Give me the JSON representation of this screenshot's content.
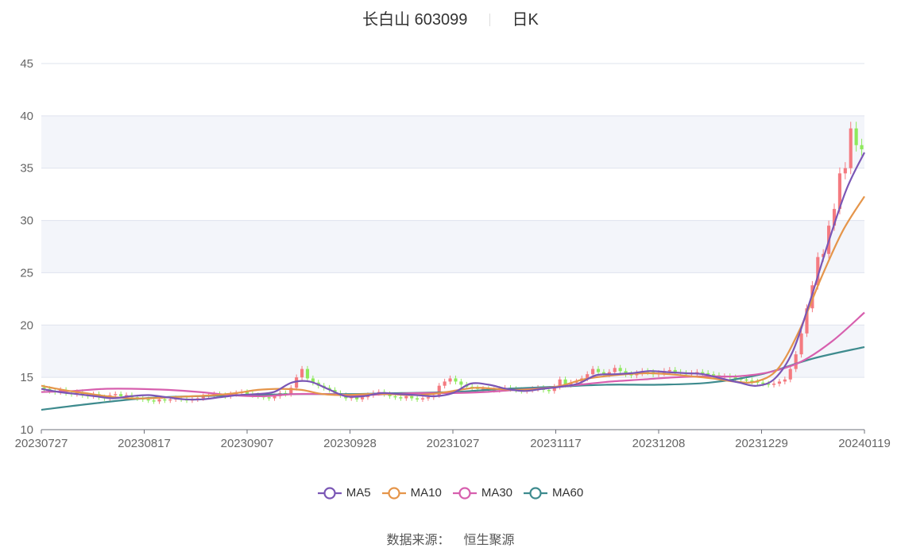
{
  "header": {
    "stock_title": "长白山 603099",
    "period_label": "日K"
  },
  "footer": {
    "source_label": "数据来源：",
    "source_value": "恒生聚源"
  },
  "colors": {
    "up": "#f47a80",
    "down": "#8ee95c",
    "MA5": "#7a56b5",
    "MA10": "#e5954a",
    "MA30": "#d75fae",
    "MA60": "#3e8b8e",
    "band": "#f3f5fa",
    "grid": "#dfe3ee"
  },
  "chart_data": {
    "type": "candlestick",
    "ylim": [
      10,
      45
    ],
    "y_ticks": [
      "10",
      "15",
      "20",
      "25",
      "30",
      "35",
      "40",
      "45"
    ],
    "x_tick_labels": [
      "20230727",
      "20230817",
      "20230907",
      "20230928",
      "20231027",
      "20231117",
      "20231208",
      "20231229",
      "20240119"
    ],
    "grid": "horizontal",
    "legend_position": "bottom",
    "legend": [
      "MA5",
      "MA10",
      "MA30",
      "MA60"
    ],
    "close_approx": [
      13.9,
      13.7,
      13.6,
      13.8,
      13.5,
      13.4,
      13.6,
      13.3,
      13.2,
      13.4,
      13.1,
      13.0,
      13.3,
      13.4,
      13.2,
      13.3,
      13.1,
      13.0,
      12.9,
      12.8,
      12.7,
      12.9,
      12.8,
      12.9,
      13.0,
      12.9,
      12.8,
      12.9,
      13.0,
      13.2,
      13.3,
      13.4,
      13.3,
      13.2,
      13.4,
      13.5,
      13.6,
      13.4,
      13.3,
      13.2,
      13.1,
      13.0,
      13.2,
      13.5,
      13.4,
      14.0,
      15.0,
      15.8,
      14.9,
      14.5,
      14.2,
      14.0,
      13.8,
      13.5,
      13.3,
      13.0,
      13.2,
      12.9,
      13.1,
      13.3,
      13.5,
      13.6,
      13.4,
      13.2,
      13.1,
      13.0,
      13.2,
      13.0,
      12.9,
      13.0,
      13.1,
      13.3,
      14.2,
      14.6,
      14.9,
      14.6,
      14.3,
      14.1,
      14.0,
      13.9,
      13.9,
      13.8,
      13.8,
      13.9,
      14.0,
      13.9,
      13.8,
      13.7,
      13.8,
      13.9,
      14.0,
      13.8,
      13.7,
      14.1,
      14.8,
      14.3,
      14.5,
      14.6,
      14.9,
      15.3,
      15.8,
      15.5,
      15.3,
      15.5,
      15.9,
      15.6,
      15.3,
      15.2,
      15.4,
      15.6,
      15.5,
      15.3,
      15.4,
      15.6,
      15.7,
      15.5,
      15.4,
      15.3,
      15.4,
      15.5,
      15.4,
      15.3,
      15.2,
      15.0,
      15.1,
      15.0,
      14.9,
      14.8,
      14.7,
      14.6,
      14.5,
      14.4,
      14.3,
      14.4,
      14.6,
      14.8,
      15.8,
      17.2,
      19.2,
      21.6,
      23.8,
      26.5,
      26.8,
      29.5,
      31.1,
      34.5,
      35.0,
      38.8,
      37.2,
      36.8
    ],
    "MA5_approx": [
      13.9,
      13.6,
      13.4,
      13.2,
      13.0,
      13.2,
      13.3,
      13.1,
      12.9,
      12.9,
      13.1,
      13.3,
      13.4,
      13.6,
      14.5,
      14.6,
      13.9,
      13.2,
      13.2,
      13.5,
      13.4,
      13.3,
      13.2,
      13.5,
      14.4,
      14.3,
      13.9,
      13.7,
      13.9,
      14.1,
      14.4,
      15.2,
      15.3,
      15.4,
      15.6,
      15.5,
      15.4,
      15.3,
      14.9,
      14.5,
      14.2,
      14.9,
      17.5,
      22.5,
      28.0,
      33.0,
      36.5
    ],
    "MA10_approx": [
      14.2,
      13.8,
      13.5,
      13.2,
      13.0,
      13.0,
      13.1,
      13.2,
      13.3,
      13.5,
      13.8,
      13.9,
      13.8,
      13.4,
      13.3,
      13.4,
      13.4,
      13.3,
      13.4,
      13.7,
      14.0,
      13.9,
      13.8,
      13.9,
      14.2,
      14.8,
      15.1,
      15.3,
      15.4,
      15.3,
      15.1,
      14.9,
      14.6,
      14.6,
      15.8,
      19.5,
      24.5,
      29.0,
      32.3
    ],
    "MA30_approx": [
      13.6,
      13.7,
      13.9,
      13.9,
      13.8,
      13.6,
      13.3,
      13.2,
      13.4,
      13.4,
      13.3,
      13.4,
      13.5,
      13.5,
      13.6,
      13.8,
      14.0,
      14.3,
      14.6,
      14.8,
      15.0,
      15.1,
      15.1,
      15.5,
      16.5,
      18.5,
      21.2
    ],
    "MA60_approx": [
      11.9,
      12.5,
      13.0,
      13.2,
      13.3,
      13.4,
      13.4,
      13.5,
      13.6,
      13.9,
      14.1,
      14.3,
      14.3,
      14.5,
      15.3,
      16.8,
      17.9
    ]
  }
}
